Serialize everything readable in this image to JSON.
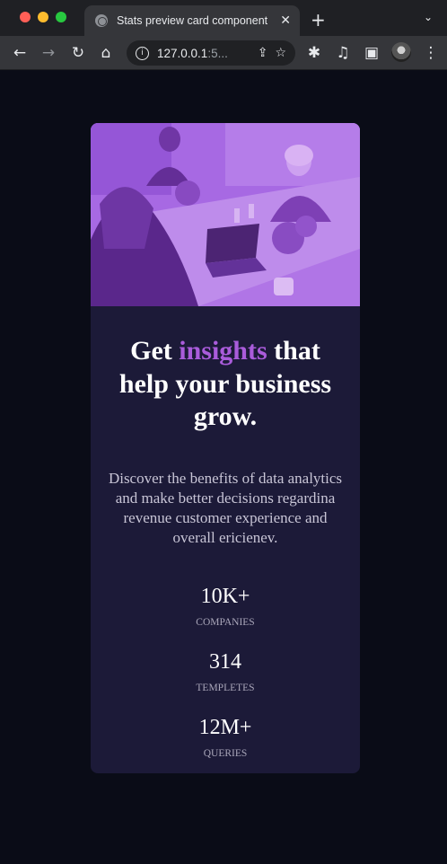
{
  "browser": {
    "tab_title": "Stats preview card component",
    "tab_close": "✕",
    "new_tab": "+",
    "tab_menu": "⌄",
    "url_main": "127.0.0.1",
    "url_rest": ":5...",
    "icons": [
      "back-icon",
      "forward-icon",
      "reload-icon",
      "home-icon",
      "info-icon",
      "share-icon",
      "star-icon",
      "extensions-icon",
      "media-icon",
      "sidepanel-icon",
      "avatar",
      "menu-icon"
    ]
  },
  "card": {
    "headline_before": "Get ",
    "headline_accent": "insights",
    "headline_after": " that help your business grow.",
    "accent_color": "#aa5cdb",
    "description": "Discover the benefits of data analytics and make better decisions regardina revenue customer experience and overall ericienev.",
    "stats": [
      {
        "value": "10K+",
        "label": "Companies"
      },
      {
        "value": "314",
        "label": "Templetes"
      },
      {
        "value": "12M+",
        "label": "Queries"
      }
    ]
  }
}
